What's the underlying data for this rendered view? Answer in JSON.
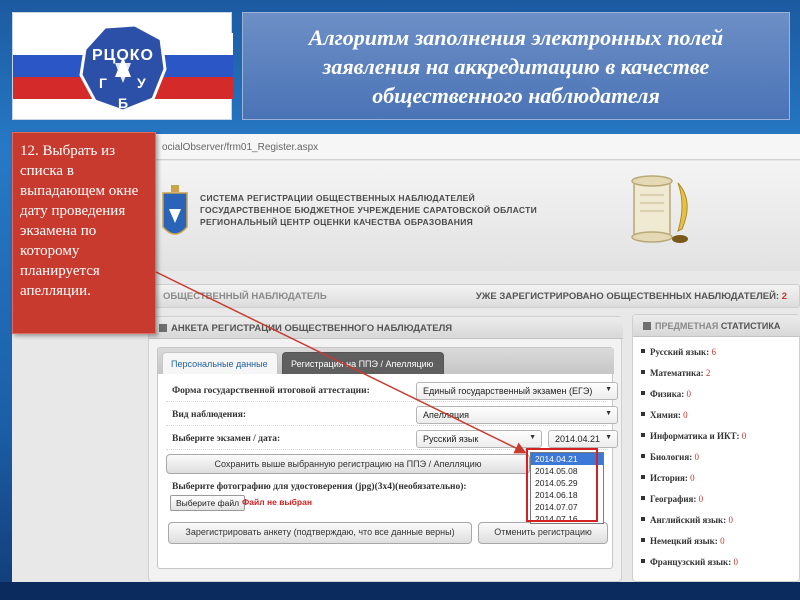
{
  "slide": {
    "title": "Алгоритм заполнения электронных полей заявления на аккредитацию в качестве общественного наблюдателя",
    "logo_text": "РЦОКО",
    "logo_letters": [
      "Г",
      "У",
      "Б"
    ],
    "callout_text": "12. Выбрать из списка в выпадающем окне дату проведения экзамена по которому планируется апелляции."
  },
  "browser": {
    "url": "ocialObserver/frm01_Register.aspx"
  },
  "header": {
    "org_line1": "СИСТЕМА РЕГИСТРАЦИИ ОБЩЕСТВЕННЫХ НАБЛЮДАТЕЛЕЙ",
    "org_line2": "ГОСУДАРСТВЕННОЕ БЮДЖЕТНОЕ УЧРЕЖДЕНИЕ САРАТОВСКОЙ ОБЛАСТИ",
    "org_line3": "РЕГИОНАЛЬНЫЙ ЦЕНТР ОЦЕНКИ КАЧЕСТВА ОБРАЗОВАНИЯ"
  },
  "status": {
    "left": "ОБЩЕСТВЕННЫЙ НАБЛЮДАТЕЛЬ",
    "right_label": "УЖЕ ЗАРЕГИСТРИРОВАНО ОБЩЕСТВЕННЫХ НАБЛЮДАТЕЛЕЙ:",
    "right_count": "2"
  },
  "form": {
    "panel_title": "АНКЕТА РЕГИСТРАЦИИ ОБЩЕСТВЕННОГО НАБЛЮДАТЕЛЯ",
    "tabs": [
      {
        "label": "Персональные данные"
      },
      {
        "label": "Регистрация на ППЭ / Апелляцию"
      }
    ],
    "attestation_label": "Форма государственной итоговой аттестации:",
    "attestation_value": "Единый государственный экзамен (ЕГЭ)",
    "observation_label": "Вид наблюдения:",
    "observation_value": "Апелляция",
    "exam_label": "Выберите экзамен / дата:",
    "exam_value": "Русский язык",
    "date_value": "2014.04.21",
    "date_options": [
      "2014.04.21",
      "2014.05.08",
      "2014.05.29",
      "2014.06.18",
      "2014.07.07",
      "2014.07.16"
    ],
    "save_button": "Сохранить выше выбранную регистрацию на ППЭ / Апелляцию",
    "photo_label": "Выберите фотографию для удостоверения (jpg)(3x4)(необязательно):",
    "file_button": "Выберите файл",
    "file_status": "Файл не выбран",
    "register_button": "Зарегистрировать анкету (подтверждаю, что все данные верны)",
    "cancel_button": "Отменить регистрацию"
  },
  "stats": {
    "title_accent": "ПРЕДМЕТНАЯ",
    "title_rest": "СТАТИСТИКА",
    "items": [
      {
        "subject": "Русский язык:",
        "count": "6"
      },
      {
        "subject": "Математика:",
        "count": "2"
      },
      {
        "subject": "Физика:",
        "count": "0"
      },
      {
        "subject": "Химия:",
        "count": "0"
      },
      {
        "subject": "Информатика и ИКТ:",
        "count": "0"
      },
      {
        "subject": "Биология:",
        "count": "0"
      },
      {
        "subject": "История:",
        "count": "0"
      },
      {
        "subject": "География:",
        "count": "0"
      },
      {
        "subject": "Английский язык:",
        "count": "0"
      },
      {
        "subject": "Немецкий язык:",
        "count": "0"
      },
      {
        "subject": "Французский язык:",
        "count": "0"
      }
    ]
  },
  "colors": {
    "accent_red": "#c8392e",
    "highlight": "#d42121",
    "slide_blue": "#1f6bb0",
    "banner_blue": "#4a73b6"
  }
}
